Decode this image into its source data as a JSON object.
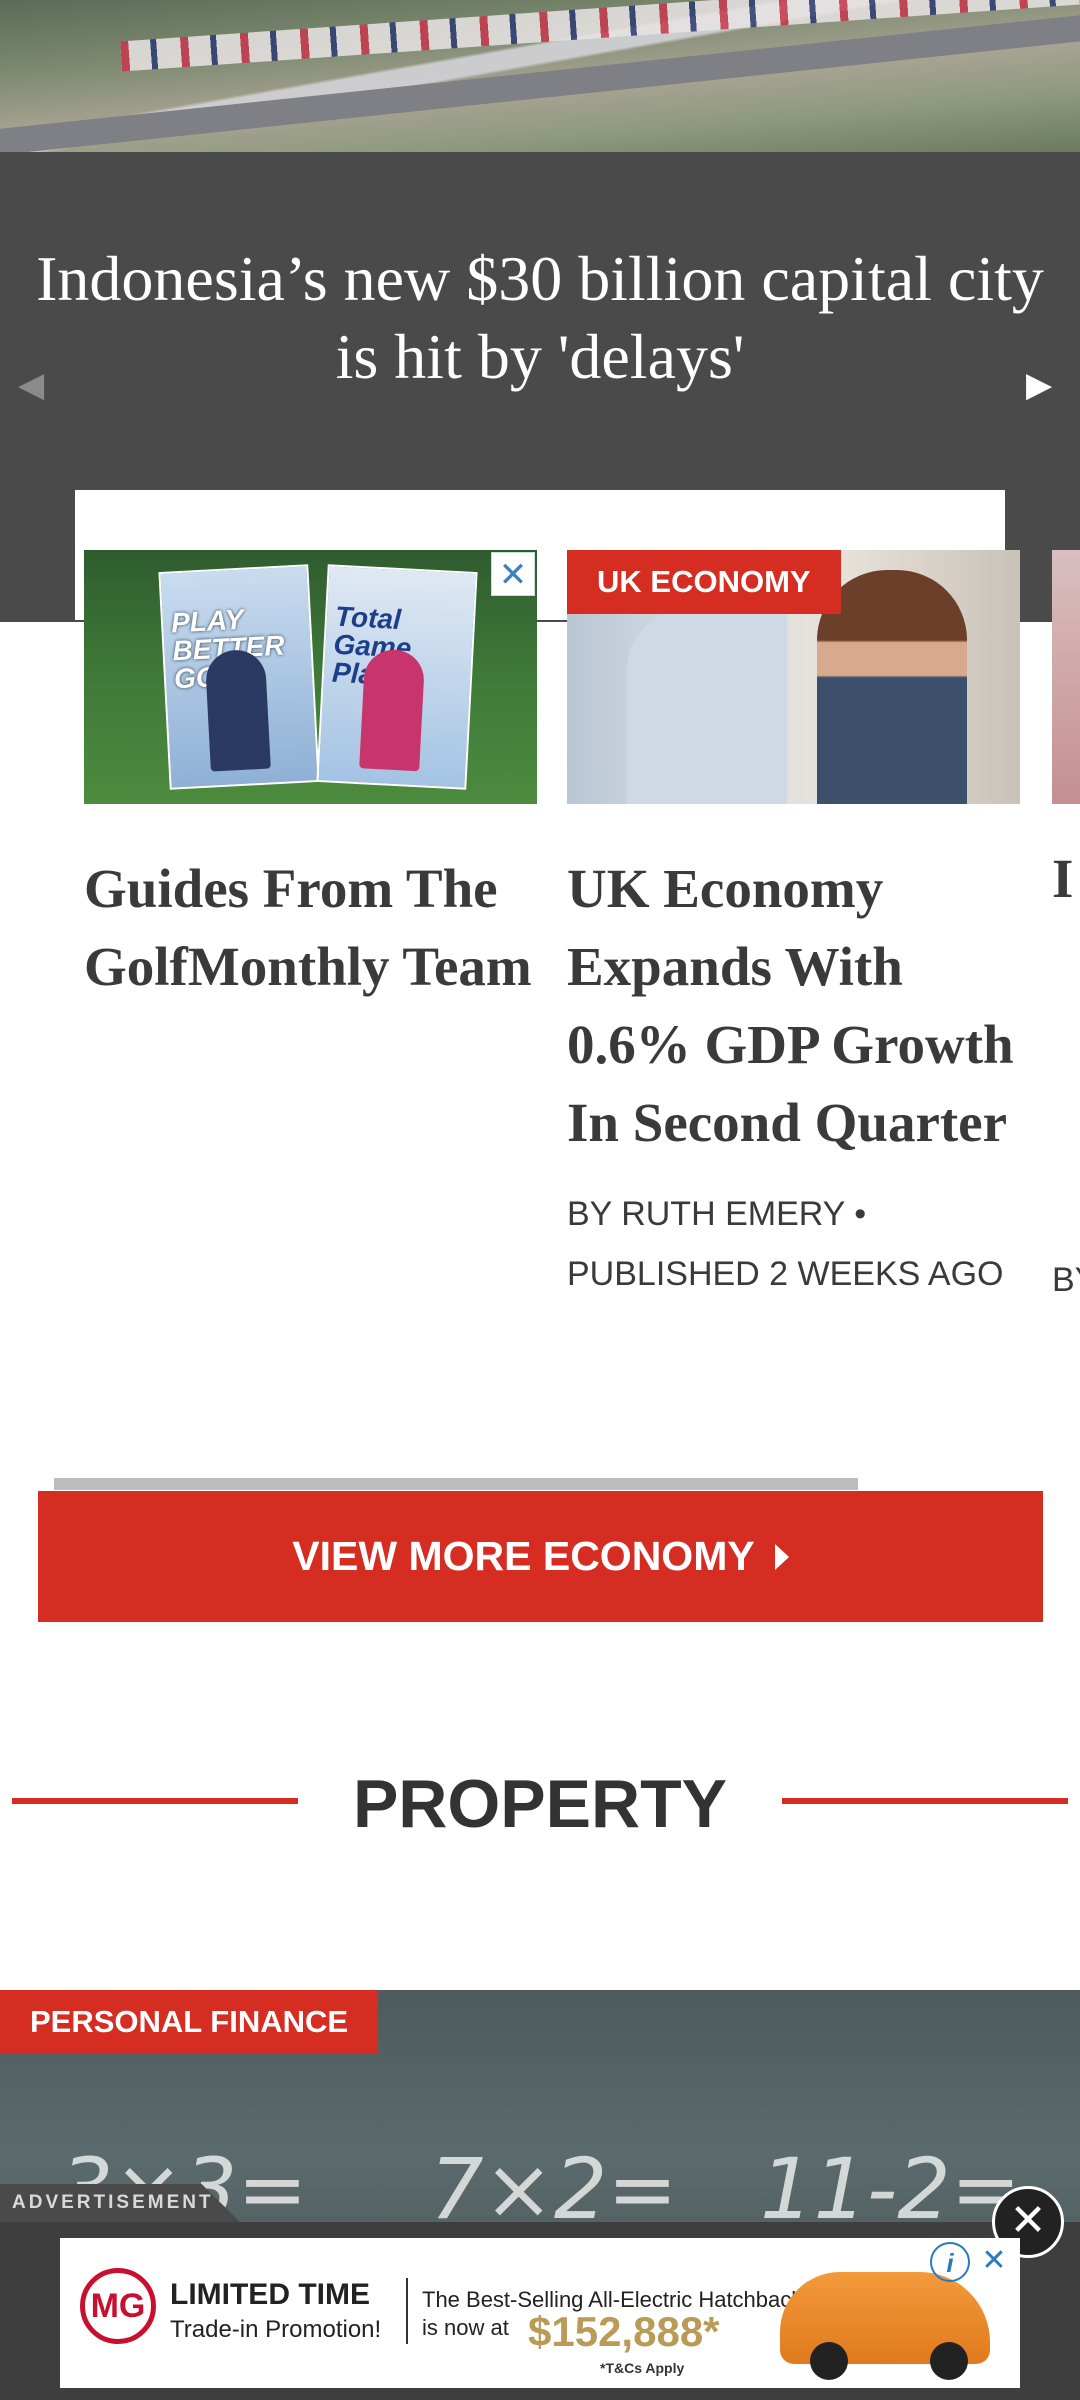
{
  "hero": {
    "title": "Indonesia’s new $30 billion capital city is hit by 'delays'",
    "prev_arrow": "◀",
    "next_arrow": "▶"
  },
  "carousel": {
    "cards": [
      {
        "ad_close": "✕",
        "magazine_1_title": "PLAY BETTER GOLF",
        "magazine_2_title": "Total Game Plan",
        "title": "Guides From The GolfMonthly Team"
      },
      {
        "tag": "UK ECONOMY",
        "title": "UK Economy Expands With 0.6% GDP Growth In Second Quarter",
        "meta": "BY RUTH EMERY • PUBLISHED 2 WEEKS AGO"
      },
      {
        "title_fragment": "I T D F M",
        "meta_fragment": "BY PU AG"
      }
    ]
  },
  "view_more": {
    "label": "VIEW MORE ECONOMY"
  },
  "section": {
    "heading": "PROPERTY"
  },
  "finance": {
    "tag": "PERSONAL FINANCE",
    "chalk_1": "3×3=",
    "chalk_2": "7×2=",
    "chalk_3": "11-2="
  },
  "ad": {
    "label": "ADVERTISEMENT",
    "close": "✕",
    "brand": "MG",
    "headline": "LIMITED TIME",
    "sub": "Trade-in Promotion!",
    "copy_1": "The Best-Selling All-Electric Hatchback",
    "copy_2": "is now at",
    "price": "$152,888*",
    "tc": "*T&Cs Apply",
    "info": "i",
    "x": "✕"
  },
  "colors": {
    "accent_red": "#d62d23",
    "band_gray": "#4a4a4a",
    "text_dark": "#3a3a3a"
  }
}
